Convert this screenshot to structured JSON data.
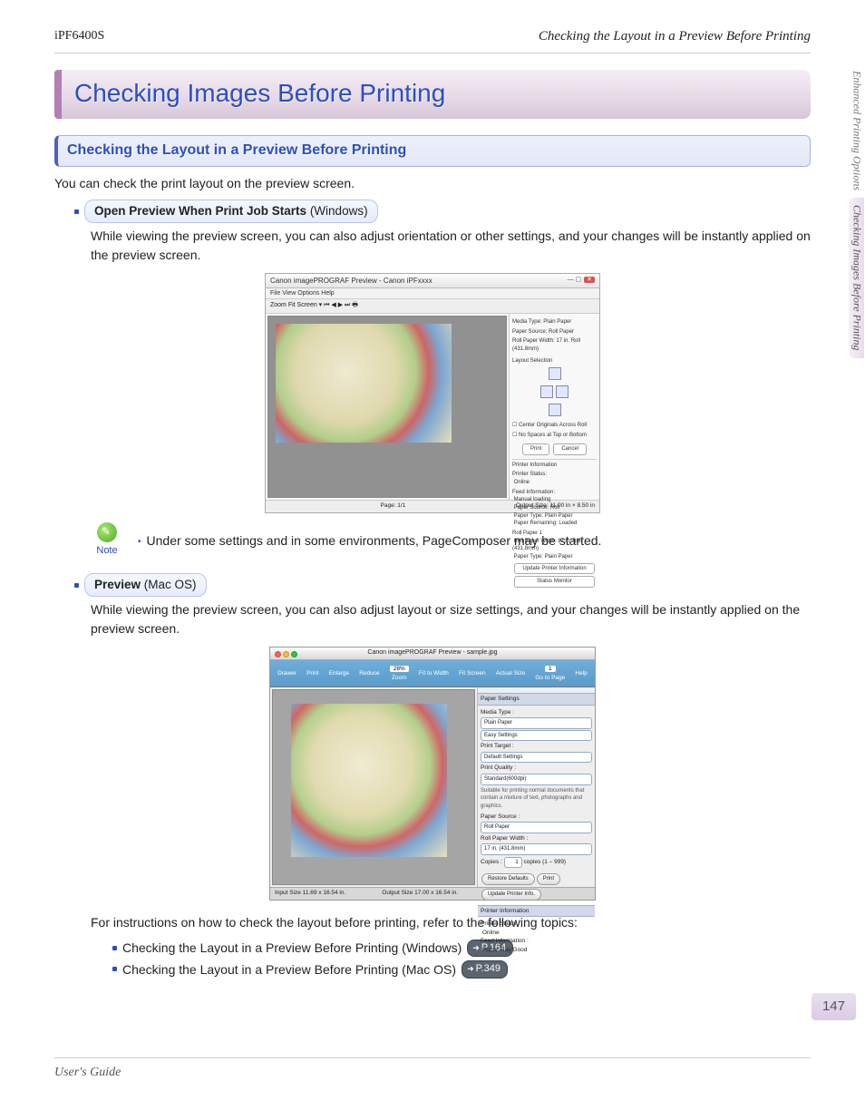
{
  "header": {
    "model": "iPF6400S",
    "breadcrumb": "Checking the Layout in a Preview Before Printing"
  },
  "sideTabs": {
    "parent": "Enhanced Printing Options",
    "current": "Checking Images Before Printing"
  },
  "chapter": {
    "title": "Checking Images Before Printing"
  },
  "section": {
    "title": "Checking the Layout in a Preview Before Printing"
  },
  "intro": "You can check the print layout on the preview screen.",
  "winBullet": {
    "bold": "Open Preview When Print Job Starts",
    "paren": " (Windows)"
  },
  "winDesc": "While viewing the preview screen, you can also adjust orientation or other settings, and your changes will be instantly applied on the preview screen.",
  "winShot": {
    "title": "Canon imagePROGRAF Preview - Canon iPFxxxx",
    "menu": "File   View   Options   Help",
    "toolbar": "Zoom   Fit Screen   ▾   ⏮ ◀ ▶ ⏭ 🖶",
    "side": {
      "mediaType": "Media Type:",
      "mediaTypeV": "Plain Paper",
      "paperSource": "Paper Source:",
      "paperSourceV": "Roll Paper",
      "rollWidth": "Roll Paper Width:",
      "rollWidthV": "17 in. Roll (431.8mm)",
      "layoutSel": "Layout Selection",
      "center": "Center Originals Across Roll",
      "nospace": "No Spaces at Top or Bottom",
      "print": "Print",
      "cancel": "Cancel",
      "pinfo": "Printer Information",
      "pstatus": "Printer Status:",
      "pstatusV": "Online",
      "feed": "Feed Information:",
      "feedV1": "Manual loading",
      "feedV2": "Paper Source: Roll",
      "feedV3": "Paper Type: Plain Paper",
      "feedV4": "Paper Remaining: Loaded",
      "rp1": "Roll Paper 1",
      "rp1a": "Roll Paper Width: 17 in. Roll (431.8mm)",
      "rp1b": "Paper Type: Plain Paper",
      "upd": "Update Printer Information",
      "sm": "Status Monitor"
    },
    "footerL": "Page: 1/1",
    "footerR": "Output Size: 11.00 in × 8.50 in"
  },
  "note": {
    "label": "Note",
    "text": "Under some settings and in some environments, PageComposer may be started."
  },
  "macBullet": {
    "bold": "Preview",
    "paren": " (Mac OS)"
  },
  "macDesc": "While viewing the preview screen, you can also adjust layout or size settings, and your changes will be instantly applied on the preview screen.",
  "macShot": {
    "title": "Canon imagePROGRAF Preview - sample.jpg",
    "tb": {
      "drawer": "Drawer",
      "print": "Print",
      "enlarge": "Enlarge",
      "reduce": "Reduce",
      "zoom": "Zoom",
      "fitw": "Fit to Width",
      "fits": "Fit Screen",
      "actual": "Actual Size",
      "goto": "Go to Page",
      "help": "Help",
      "zoomv": "28%",
      "pagev": "1"
    },
    "side": {
      "paperSettings": "Paper Settings",
      "mediaType": "Media Type :",
      "mediaTypeV": "Plain Paper",
      "easy": "Easy Settings",
      "printTarget": "Print Target :",
      "printTargetV": "Default Settings",
      "printQuality": "Print Quality :",
      "printQualityV": "Standard(600dpi)",
      "hint": "Suitable for printing normal documents that contain a mixture of text, photographs and graphics.",
      "paperSource": "Paper Source :",
      "paperSourceV": "Roll Paper",
      "rollWidth": "Roll Paper Width :",
      "rollWidthV": "17 in. (431.8mm)",
      "copies": "Copies :",
      "copiesV": "1",
      "copiesRange": "copies (1 – 999)",
      "restore": "Restore Defaults",
      "print": "Print",
      "update": "Update Printer Info.",
      "pinfo": "Printer Information",
      "pstatus": "Printer Status :",
      "pstatusV": "Online",
      "feed": "Feed Information :",
      "feedV": "Paper Tray:Good"
    },
    "footerL": "Input Size 11.69 x 16.54 in.",
    "footerR": "Output Size 17.00 x 16.54 in."
  },
  "instructions": "For instructions on how to check the layout before printing, refer to the following topics:",
  "topics": [
    {
      "text": "Checking the Layout in a Preview Before Printing (Windows)",
      "ref": "P.164"
    },
    {
      "text": "Checking the Layout in a Preview Before Printing (Mac OS)",
      "ref": "P.349"
    }
  ],
  "pageNumber": "147",
  "footer": "User's Guide"
}
